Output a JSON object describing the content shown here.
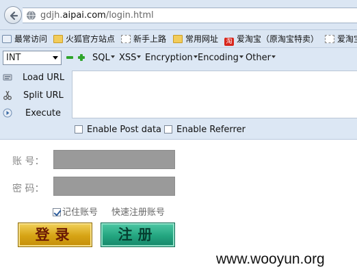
{
  "browser": {
    "url_prefix": "gdjh.",
    "url_domain": "aipai.com",
    "url_path": "/login.html"
  },
  "bookmarks": [
    {
      "label": "最常访问",
      "icon": "bookmark-star-icon"
    },
    {
      "label": "火狐官方站点",
      "icon": "folder-icon"
    },
    {
      "label": "新手上路",
      "icon": "page-icon"
    },
    {
      "label": "常用网址",
      "icon": "folder-icon"
    },
    {
      "label": "爱淘宝（原淘宝特卖）",
      "icon": "taobao-icon"
    },
    {
      "label": "爱淘宝",
      "icon": "page-icon"
    }
  ],
  "hackbar": {
    "select_value": "INT",
    "menus": [
      "SQL",
      "XSS",
      "Encryption",
      "Encoding",
      "Other"
    ],
    "actions": [
      "Load URL",
      "Split URL",
      "Execute"
    ],
    "checkboxes": [
      "Enable Post data",
      "Enable Referrer"
    ]
  },
  "login": {
    "account_label": "账    号：",
    "password_label": "密    码：",
    "remember_label": "记住账号",
    "quick_register": "快速注册账号",
    "login_button": "登录",
    "register_button": "注册"
  },
  "watermark": "www.wooyun.org",
  "colors": {
    "login_button": "#d6a314",
    "register_button": "#23a57f",
    "input_fill": "#9a9a9a"
  }
}
